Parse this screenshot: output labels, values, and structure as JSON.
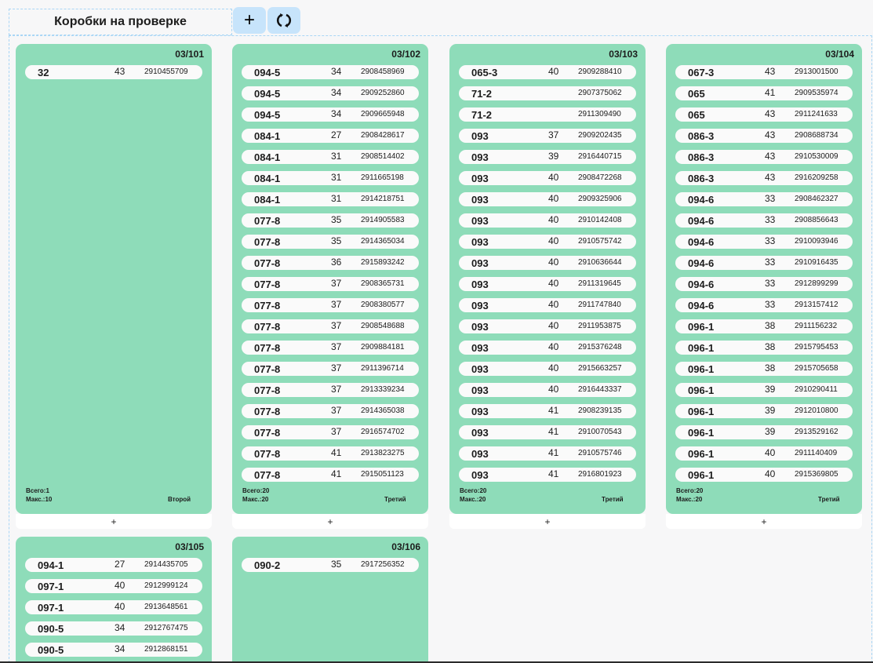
{
  "header": {
    "title": "Коробки на проверке",
    "add_label": "+",
    "refresh_icon": "refresh-icon"
  },
  "labels": {
    "total_prefix": "Всего:",
    "max_prefix": "Макс.:",
    "add_row": "+"
  },
  "boxes": [
    {
      "id": "03/101",
      "total": "1",
      "max": "10",
      "level": "Второй",
      "rows": [
        {
          "art": "32",
          "size": "43",
          "code": "2910455709"
        }
      ]
    },
    {
      "id": "03/102",
      "total": "20",
      "max": "20",
      "level": "Третий",
      "rows": [
        {
          "art": "094-5",
          "size": "34",
          "code": "2908458969"
        },
        {
          "art": "094-5",
          "size": "34",
          "code": "2909252860"
        },
        {
          "art": "094-5",
          "size": "34",
          "code": "2909665948"
        },
        {
          "art": "084-1",
          "size": "27",
          "code": "2908428617"
        },
        {
          "art": "084-1",
          "size": "31",
          "code": "2908514402"
        },
        {
          "art": "084-1",
          "size": "31",
          "code": "2911665198"
        },
        {
          "art": "084-1",
          "size": "31",
          "code": "2914218751"
        },
        {
          "art": "077-8",
          "size": "35",
          "code": "2914905583"
        },
        {
          "art": "077-8",
          "size": "35",
          "code": "2914365034"
        },
        {
          "art": "077-8",
          "size": "36",
          "code": "2915893242"
        },
        {
          "art": "077-8",
          "size": "37",
          "code": "2908365731"
        },
        {
          "art": "077-8",
          "size": "37",
          "code": "2908380577"
        },
        {
          "art": "077-8",
          "size": "37",
          "code": "2908548688"
        },
        {
          "art": "077-8",
          "size": "37",
          "code": "2909884181"
        },
        {
          "art": "077-8",
          "size": "37",
          "code": "2911396714"
        },
        {
          "art": "077-8",
          "size": "37",
          "code": "2913339234"
        },
        {
          "art": "077-8",
          "size": "37",
          "code": "2914365038"
        },
        {
          "art": "077-8",
          "size": "37",
          "code": "2916574702"
        },
        {
          "art": "077-8",
          "size": "41",
          "code": "2913823275"
        },
        {
          "art": "077-8",
          "size": "41",
          "code": "2915051123"
        }
      ]
    },
    {
      "id": "03/103",
      "total": "20",
      "max": "20",
      "level": "Третий",
      "rows": [
        {
          "art": "065-3",
          "size": "40",
          "code": "2909288410"
        },
        {
          "art": "71-2",
          "size": "",
          "code": "2907375062"
        },
        {
          "art": "71-2",
          "size": "",
          "code": "2911309490"
        },
        {
          "art": "093",
          "size": "37",
          "code": "2909202435"
        },
        {
          "art": "093",
          "size": "39",
          "code": "2916440715"
        },
        {
          "art": "093",
          "size": "40",
          "code": "2908472268"
        },
        {
          "art": "093",
          "size": "40",
          "code": "2909325906"
        },
        {
          "art": "093",
          "size": "40",
          "code": "2910142408"
        },
        {
          "art": "093",
          "size": "40",
          "code": "2910575742"
        },
        {
          "art": "093",
          "size": "40",
          "code": "2910636644"
        },
        {
          "art": "093",
          "size": "40",
          "code": "2911319645"
        },
        {
          "art": "093",
          "size": "40",
          "code": "2911747840"
        },
        {
          "art": "093",
          "size": "40",
          "code": "2911953875"
        },
        {
          "art": "093",
          "size": "40",
          "code": "2915376248"
        },
        {
          "art": "093",
          "size": "40",
          "code": "2915663257"
        },
        {
          "art": "093",
          "size": "40",
          "code": "2916443337"
        },
        {
          "art": "093",
          "size": "41",
          "code": "2908239135"
        },
        {
          "art": "093",
          "size": "41",
          "code": "2910070543"
        },
        {
          "art": "093",
          "size": "41",
          "code": "2910575746"
        },
        {
          "art": "093",
          "size": "41",
          "code": "2916801923"
        }
      ]
    },
    {
      "id": "03/104",
      "total": "20",
      "max": "20",
      "level": "Третий",
      "rows": [
        {
          "art": "067-3",
          "size": "43",
          "code": "2913001500"
        },
        {
          "art": "065",
          "size": "41",
          "code": "2909535974"
        },
        {
          "art": "065",
          "size": "43",
          "code": "2911241633"
        },
        {
          "art": "086-3",
          "size": "43",
          "code": "2908688734"
        },
        {
          "art": "086-3",
          "size": "43",
          "code": "2910530009"
        },
        {
          "art": "086-3",
          "size": "43",
          "code": "2916209258"
        },
        {
          "art": "094-6",
          "size": "33",
          "code": "2908462327"
        },
        {
          "art": "094-6",
          "size": "33",
          "code": "2908856643"
        },
        {
          "art": "094-6",
          "size": "33",
          "code": "2910093946"
        },
        {
          "art": "094-6",
          "size": "33",
          "code": "2910916435"
        },
        {
          "art": "094-6",
          "size": "33",
          "code": "2912899299"
        },
        {
          "art": "094-6",
          "size": "33",
          "code": "2913157412"
        },
        {
          "art": "096-1",
          "size": "38",
          "code": "2911156232"
        },
        {
          "art": "096-1",
          "size": "38",
          "code": "2915795453"
        },
        {
          "art": "096-1",
          "size": "38",
          "code": "2915705658"
        },
        {
          "art": "096-1",
          "size": "39",
          "code": "2910290411"
        },
        {
          "art": "096-1",
          "size": "39",
          "code": "2912010800"
        },
        {
          "art": "096-1",
          "size": "39",
          "code": "2913529162"
        },
        {
          "art": "096-1",
          "size": "40",
          "code": "2911140409"
        },
        {
          "art": "096-1",
          "size": "40",
          "code": "2915369805"
        }
      ]
    },
    {
      "id": "03/105",
      "total": "",
      "max": "",
      "level": "",
      "rows": [
        {
          "art": "094-1",
          "size": "27",
          "code": "2914435705"
        },
        {
          "art": "097-1",
          "size": "40",
          "code": "2912999124"
        },
        {
          "art": "097-1",
          "size": "40",
          "code": "2913648561"
        },
        {
          "art": "090-5",
          "size": "34",
          "code": "2912767475"
        },
        {
          "art": "090-5",
          "size": "34",
          "code": "2912868151"
        }
      ]
    },
    {
      "id": "03/106",
      "total": "",
      "max": "",
      "level": "",
      "rows": [
        {
          "art": "090-2",
          "size": "35",
          "code": "2917256352"
        }
      ]
    }
  ]
}
